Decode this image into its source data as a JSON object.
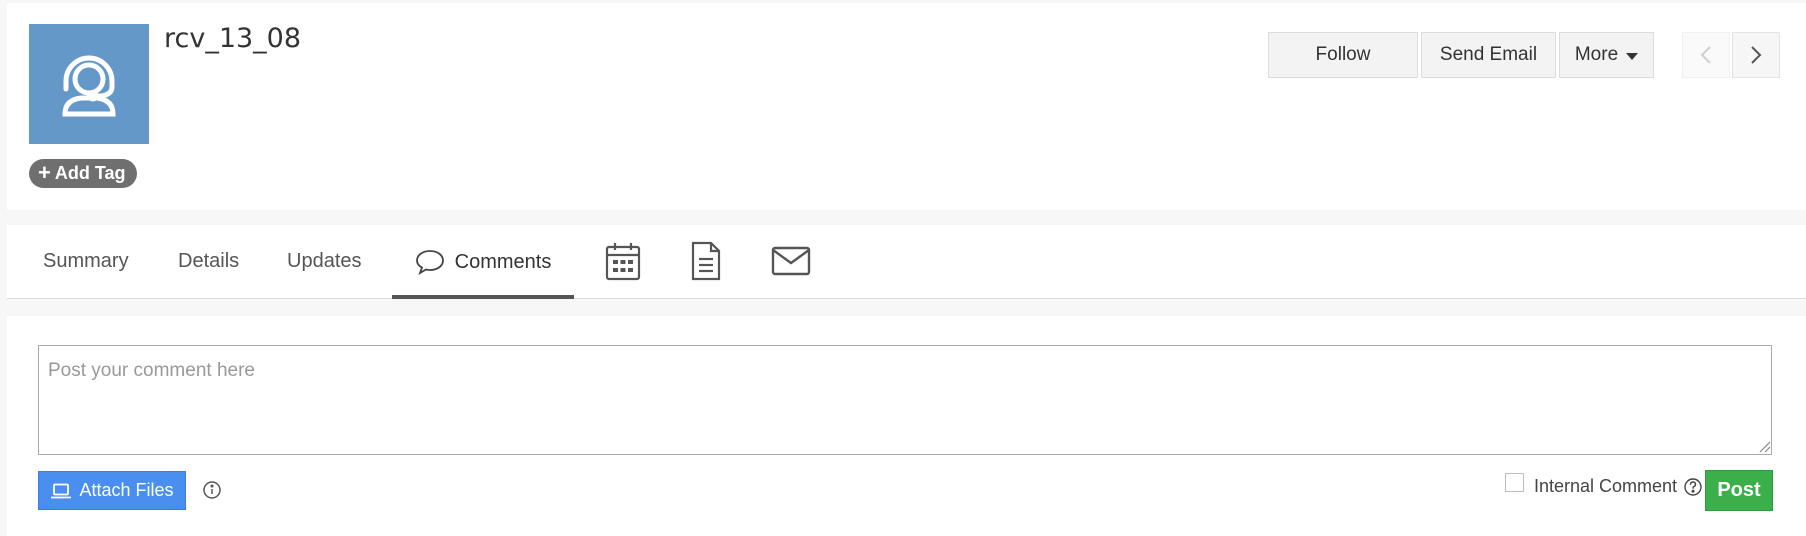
{
  "record": {
    "title": "rcv_13_08",
    "avatar_icon": "headset-agent-icon",
    "avatar_color": "#6398c8",
    "add_tag_label": "Add Tag"
  },
  "actions": {
    "follow_label": "Follow",
    "send_email_label": "Send Email",
    "more_label": "More"
  },
  "tabs": [
    {
      "label": "Summary"
    },
    {
      "label": "Details"
    },
    {
      "label": "Updates"
    },
    {
      "label": "Comments",
      "icon": "comment-bubble-icon",
      "active": true
    },
    {
      "icon": "calendar-icon"
    },
    {
      "icon": "document-icon"
    },
    {
      "icon": "mail-icon"
    }
  ],
  "comment": {
    "placeholder": "Post your comment here",
    "value": "",
    "attach_label": "Attach Files",
    "internal_label": "Internal Comment",
    "internal_checked": false,
    "post_label": "Post"
  },
  "colors": {
    "attach_blue": "#4a8ff0",
    "post_green": "#3bb04a",
    "tag_gray": "#6f6f6f"
  }
}
